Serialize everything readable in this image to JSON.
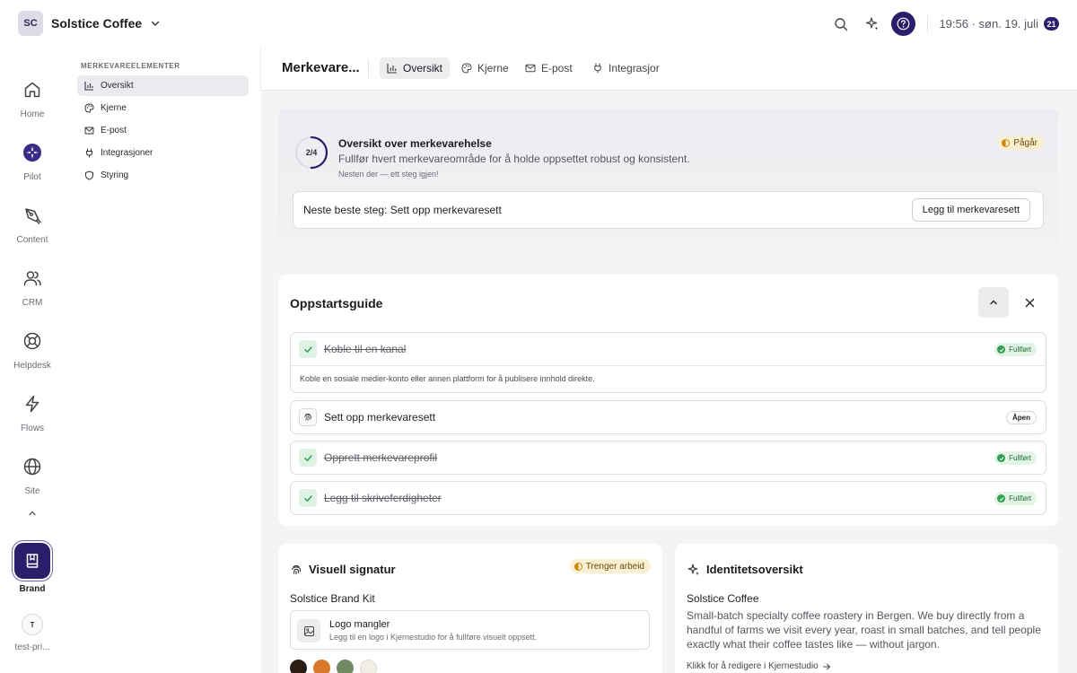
{
  "workspace": {
    "initials": "SC",
    "name": "Solstice Coffee"
  },
  "topbar": {
    "clock": "19:56 · søn. 19. juli",
    "notification_count": "21"
  },
  "rail": {
    "items": [
      {
        "label": "Home"
      },
      {
        "label": "Pilot"
      },
      {
        "label": "Content"
      },
      {
        "label": "CRM"
      },
      {
        "label": "Helpdesk"
      },
      {
        "label": "Flows"
      },
      {
        "label": "Site"
      }
    ],
    "active": {
      "label": "Brand"
    },
    "user": {
      "initial": "T",
      "label": "test-pri..."
    }
  },
  "sub_sidebar": {
    "heading": "MERKEVAREELEMENTER",
    "items": [
      {
        "label": "Oversikt"
      },
      {
        "label": "Kjerne"
      },
      {
        "label": "E-post"
      },
      {
        "label": "Integrasjoner"
      },
      {
        "label": "Styring"
      }
    ]
  },
  "header": {
    "title": "Merkevare...",
    "tabs": [
      {
        "label": "Oversikt"
      },
      {
        "label": "Kjerne"
      },
      {
        "label": "E-post"
      },
      {
        "label": "Integrasjor"
      }
    ]
  },
  "health": {
    "progress_label": "2/4",
    "progress_fraction": 0.5,
    "title": "Oversikt over merkevarehelse",
    "description": "Fullfør hvert merkevareområde for å holde oppsettet robust og konsistent.",
    "subtext": "Nesten der — ett steg igjen!",
    "status": "Pågår",
    "next_step": "Neste beste steg: Sett opp merkevaresett",
    "next_button": "Legg til merkevaresett"
  },
  "guide": {
    "title": "Oppstartsguide",
    "steps": [
      {
        "label": "Koble til en kanal",
        "status": "Fullført",
        "description": "Koble en sosiale medier-konto eller annen plattform for å publisere innhold direkte."
      },
      {
        "label": "Sett opp merkevaresett",
        "status": "Åpen"
      },
      {
        "label": "Opprett merkevareprofil",
        "status": "Fullført"
      },
      {
        "label": "Legg til skriveferdigheter",
        "status": "Fullført"
      }
    ]
  },
  "visual": {
    "title": "Visuell signatur",
    "status": "Trenger arbeid",
    "kit_name": "Solstice Brand Kit",
    "logo_title": "Logo mangler",
    "logo_desc": "Legg til en logo i Kjernestudio for å fullføre visuelt oppsett.",
    "swatches": [
      "#2b1c14",
      "#d8782a",
      "#6f8a62",
      "#f2ede6"
    ]
  },
  "identity": {
    "title": "Identitetsoversikt",
    "name": "Solstice Coffee",
    "description": "Small-batch specialty coffee roastery in Bergen. We buy directly from a handful of farms we visit every year, roast in small batches, and tell people exactly what their coffee tastes like — without jargon.",
    "link": "Klikk for å redigere i Kjernestudio"
  },
  "colors": {
    "accent": "#2c1d6b",
    "success": "#2f9e51",
    "warning": "#c98a0a"
  }
}
